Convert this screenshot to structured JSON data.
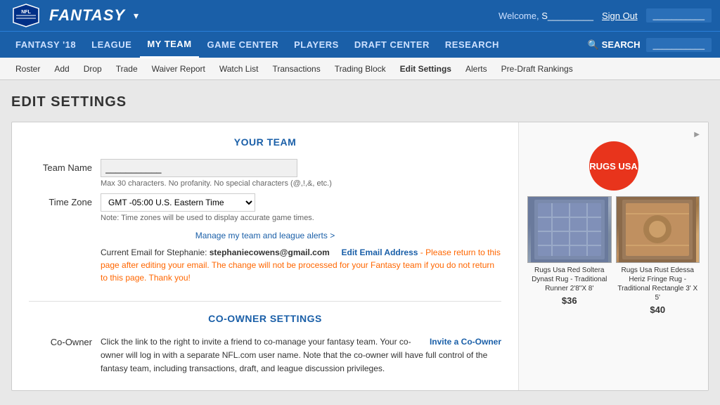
{
  "topbar": {
    "brand": "FANTASY",
    "dropdown_icon": "▾",
    "welcome": "Welcome,",
    "username": "S_________",
    "signout": "Sign Out",
    "user_team": "___________"
  },
  "main_nav": {
    "items": [
      {
        "label": "FANTASY '18",
        "active": false
      },
      {
        "label": "LEAGUE",
        "active": false
      },
      {
        "label": "MY TEAM",
        "active": true
      },
      {
        "label": "GAME CENTER",
        "active": false
      },
      {
        "label": "PLAYERS",
        "active": false
      },
      {
        "label": "DRAFT CENTER",
        "active": false
      },
      {
        "label": "RESEARCH",
        "active": false
      }
    ],
    "search_label": "SEARCH"
  },
  "sub_nav": {
    "items": [
      {
        "label": "Roster",
        "active": false
      },
      {
        "label": "Add",
        "active": false
      },
      {
        "label": "Drop",
        "active": false
      },
      {
        "label": "Trade",
        "active": false
      },
      {
        "label": "Waiver Report",
        "active": false
      },
      {
        "label": "Watch List",
        "active": false
      },
      {
        "label": "Transactions",
        "active": false
      },
      {
        "label": "Trading Block",
        "active": false
      },
      {
        "label": "Edit Settings",
        "active": true
      },
      {
        "label": "Alerts",
        "active": false
      },
      {
        "label": "Pre-Draft Rankings",
        "active": false
      }
    ]
  },
  "page": {
    "title": "EDIT SETTINGS",
    "your_team_header": "YOUR TEAM",
    "team_name_label": "Team Name",
    "team_name_value": "___________",
    "team_name_hint": "Max 30 characters. No profanity. No special characters (@,!,&, etc.)",
    "timezone_label": "Time Zone",
    "timezone_value": "GMT -05:00 U.S. Eastern Time",
    "timezone_note": "Note: Time zones will be used to display accurate game times.",
    "manage_link": "Manage my team and league alerts >",
    "email_label": "Current Email for Stephanie:",
    "email_value": "stephaniecowens@gmail.com",
    "edit_email_label": "Edit Email Address",
    "edit_note": "- Please return to this page after editing your email. The change will not be processed for your Fantasy team if you do not return to this page. Thank you!",
    "co_owner_header": "CO-OWNER SETTINGS",
    "co_owner_label": "Co-Owner",
    "co_owner_text": "Click the link to the right to invite a friend to co-manage your fantasy team. Your co-owner will log in with a separate NFL.com user name. Note that the co-owner will have full control of the fantasy team, including transactions, draft, and league discussion privileges.",
    "invite_link": "Invite a Co-Owner"
  },
  "ad": {
    "label": "▶",
    "brand": "RUGS USA",
    "img1_caption": "Rugs Usa Red Soltera Dynast Rug - Traditional Runner 2'8\"X 8'",
    "img1_price": "$36",
    "img2_caption": "Rugs Usa Rust Edessa Heriz Fringe Rug - Traditional Rectangle 3' X 5'",
    "img2_price": "$40"
  }
}
